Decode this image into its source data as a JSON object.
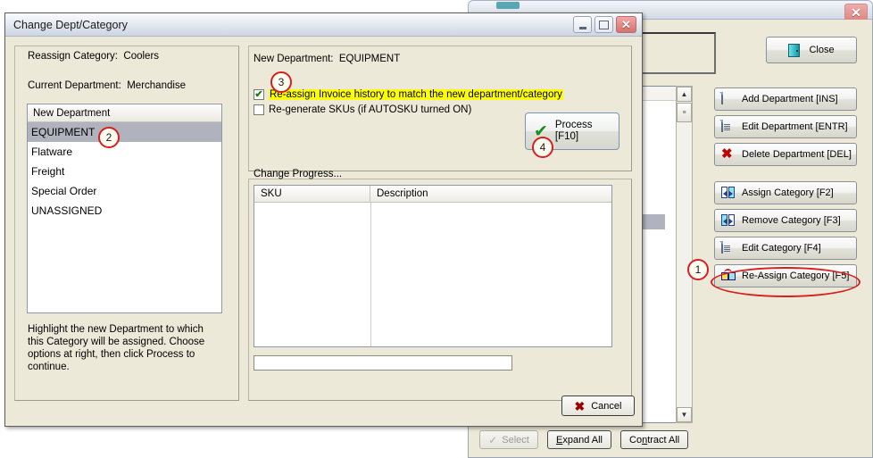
{
  "background_window": {
    "close_button": {
      "label": "Close",
      "icon": "door-exit-icon"
    },
    "window_close_glyph": "✕",
    "list_header": "",
    "action_buttons": [
      {
        "label": "Add Department [INS]",
        "icon": "page-new-icon"
      },
      {
        "label": "Edit Department [ENTR]",
        "icon": "page-edit-icon"
      },
      {
        "label": "Delete Department [DEL]",
        "icon": "red-x-icon"
      },
      {
        "label": "Assign Category [F2]",
        "icon": "assign-panes-icon"
      },
      {
        "label": "Remove Category [F3]",
        "icon": "remove-panes-icon"
      },
      {
        "label": "Edit Category [F4]",
        "icon": "page-edit-icon"
      },
      {
        "label": "Re-Assign Category [F5]",
        "icon": "reassign-boxes-icon"
      }
    ],
    "bottom_bar": {
      "select_label": "Select",
      "select_disabled": true,
      "expand_all": {
        "prefix": "",
        "mnemonic": "E",
        "rest": "xpand All"
      },
      "contract_all": {
        "prefix": "Co",
        "mnemonic": "n",
        "rest": "tract All"
      }
    },
    "scrollbar": {
      "up_arrow": "▲",
      "down_arrow": "▼",
      "thumb_grip": "≡"
    }
  },
  "dialog": {
    "title": "Change Dept/Category",
    "window_buttons": {
      "minimize": "minimize-icon",
      "maximize": "maximize-icon",
      "close": "✕"
    },
    "left_panel": {
      "reassign_category_label": "Reassign Category:",
      "reassign_category_value": "Coolers",
      "current_department_label": "Current Department:",
      "current_department_value": "Merchandise",
      "list_header": "New Department",
      "departments": [
        {
          "name": "EQUIPMENT",
          "selected": true
        },
        {
          "name": "Flatware",
          "selected": false
        },
        {
          "name": "Freight",
          "selected": false
        },
        {
          "name": "Special Order",
          "selected": false
        },
        {
          "name": "UNASSIGNED",
          "selected": false
        }
      ],
      "help_text": "Highlight the new Department to which this Category will be assigned.  Choose options at right, then click Process to continue."
    },
    "right_panel": {
      "new_department_label": "New Department:",
      "new_department_value": "EQUIPMENT",
      "checkboxes": [
        {
          "label": "Re-assign Invoice history to match the new department/category",
          "checked": true,
          "highlighted": true,
          "check_glyph": "✔"
        },
        {
          "label": "Re-generate SKUs (if AUTOSKU turned ON)",
          "checked": false,
          "highlighted": false,
          "check_glyph": ""
        }
      ],
      "process_button": {
        "line1": "Process",
        "line2": "[F10]",
        "icon": "green-check-icon",
        "check_glyph": "✔"
      }
    },
    "progress_panel": {
      "label": "Change Progress...",
      "columns": [
        "SKU",
        "Description"
      ],
      "rows": [],
      "progress_percent": 0
    },
    "cancel_button": {
      "label": "Cancel",
      "icon": "red-x-icon",
      "glyph": "✖"
    }
  },
  "annotations": [
    {
      "number": "1",
      "target": "re-assign-category-button"
    },
    {
      "number": "2",
      "target": "equipment-list-item"
    },
    {
      "number": "3",
      "target": "reassign-invoice-history-checkbox"
    },
    {
      "number": "4",
      "target": "process-button"
    }
  ],
  "colors": {
    "annotation_red": "#d81f1f",
    "highlight_yellow": "#ffff00",
    "selection_grey": "#b0b3bd",
    "dialog_face": "#ece9d8",
    "green_check": "#16901c"
  }
}
